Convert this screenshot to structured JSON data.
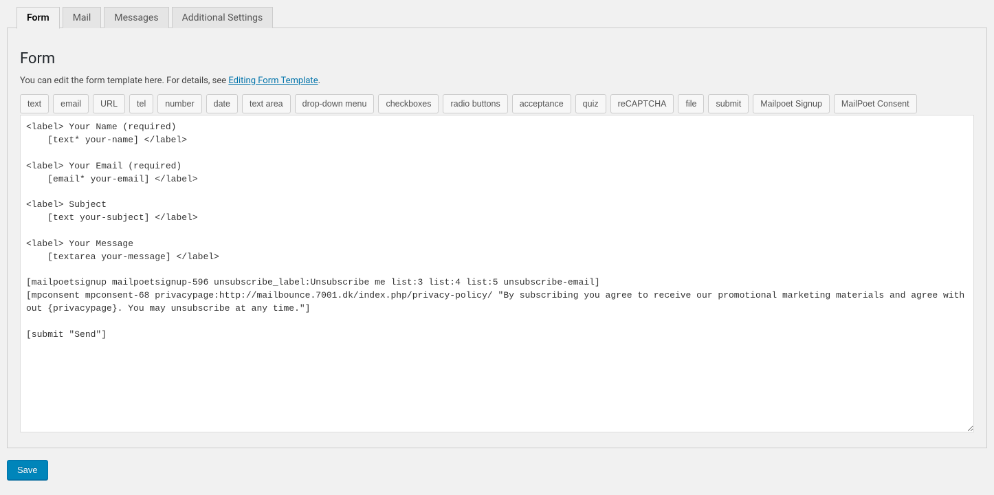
{
  "tabs": [
    {
      "label": "Form",
      "active": true
    },
    {
      "label": "Mail",
      "active": false
    },
    {
      "label": "Messages",
      "active": false
    },
    {
      "label": "Additional Settings",
      "active": false
    }
  ],
  "form": {
    "heading": "Form",
    "helpTextPrefix": "You can edit the form template here. For details, see ",
    "helpLinkText": "Editing Form Template",
    "helpTextSuffix": ".",
    "tagButtons": [
      "text",
      "email",
      "URL",
      "tel",
      "number",
      "date",
      "text area",
      "drop-down menu",
      "checkboxes",
      "radio buttons",
      "acceptance",
      "quiz",
      "reCAPTCHA",
      "file",
      "submit",
      "Mailpoet Signup",
      "MailPoet Consent"
    ],
    "template": "<label> Your Name (required)\n    [text* your-name] </label>\n\n<label> Your Email (required)\n    [email* your-email] </label>\n\n<label> Subject\n    [text your-subject] </label>\n\n<label> Your Message\n    [textarea your-message] </label>\n\n[mailpoetsignup mailpoetsignup-596 unsubscribe_label:Unsubscribe me list:3 list:4 list:5 unsubscribe-email]\n[mpconsent mpconsent-68 privacypage:http://mailbounce.7001.dk/index.php/privacy-policy/ \"By subscribing you agree to receive our promotional marketing materials and agree with out {privacypage}. You may unsubscribe at any time.\"]\n\n[submit \"Send\"]"
  },
  "saveLabel": "Save"
}
